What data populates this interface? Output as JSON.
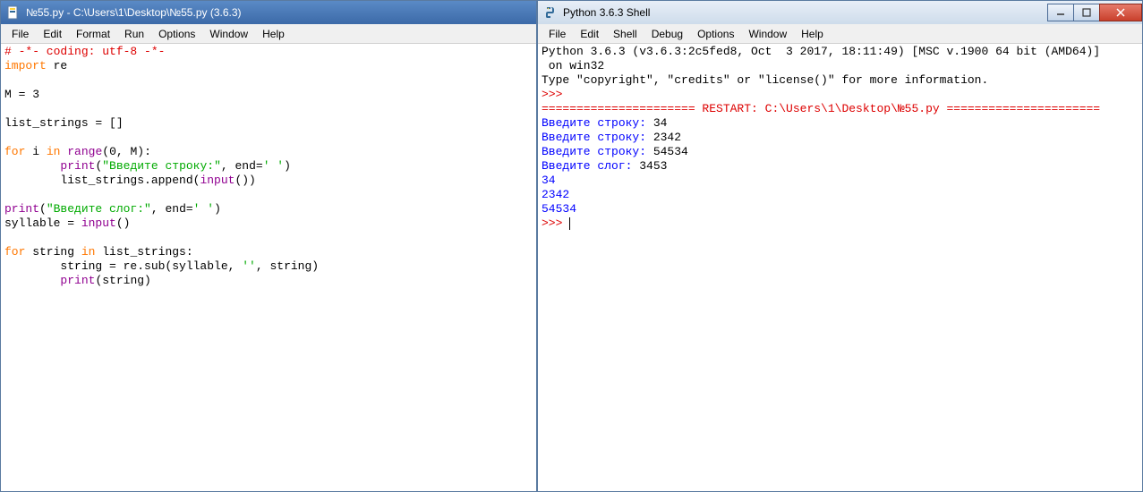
{
  "editor": {
    "title": "№55.py - C:\\Users\\1\\Desktop\\№55.py (3.6.3)",
    "menus": [
      "File",
      "Edit",
      "Format",
      "Run",
      "Options",
      "Window",
      "Help"
    ],
    "code": {
      "l1a": "# -*- coding: utf-8 -*-",
      "l2a": "import",
      "l2b": " re",
      "l3a": "M = ",
      "l3b": "3",
      "l4a": "list_strings = []",
      "l5a": "for",
      "l5b": " i ",
      "l5c": "in",
      "l5d": " ",
      "l5e": "range",
      "l5f": "(",
      "l5g": "0",
      "l5h": ", M):",
      "l6a": "        ",
      "l6b": "print",
      "l6c": "(",
      "l6d": "\"Введите строку:\"",
      "l6e": ", end=",
      "l6f": "' '",
      "l6g": ")",
      "l7a": "        list_strings.append(",
      "l7b": "input",
      "l7c": "())",
      "l8a": "print",
      "l8b": "(",
      "l8c": "\"Введите слог:\"",
      "l8d": ", end=",
      "l8e": "' '",
      "l8f": ")",
      "l9a": "syllable = ",
      "l9b": "input",
      "l9c": "()",
      "l10a": "for",
      "l10b": " string ",
      "l10c": "in",
      "l10d": " list_strings:",
      "l11a": "        string = re.sub(syllable, ",
      "l11b": "''",
      "l11c": ", string)",
      "l12a": "        ",
      "l12b": "print",
      "l12c": "(string)"
    }
  },
  "shell": {
    "title": "Python 3.6.3 Shell",
    "menus": [
      "File",
      "Edit",
      "Shell",
      "Debug",
      "Options",
      "Window",
      "Help"
    ],
    "output": {
      "banner1": "Python 3.6.3 (v3.6.3:2c5fed8, Oct  3 2017, 18:11:49) [MSC v.1900 64 bit (AMD64)]\n on win32",
      "banner2": "Type \"copyright\", \"credits\" or \"license()\" for more information.",
      "prompt": ">>>",
      "restart": "====================== RESTART: C:\\Users\\1\\Desktop\\№55.py ======================",
      "in1a": "Введите строку:",
      "in1b": " 34",
      "in2a": "Введите строку:",
      "in2b": " 2342",
      "in3a": "Введите строку:",
      "in3b": " 54534",
      "in4a": "Введите слог:",
      "in4b": " 3453",
      "out1": "34",
      "out2": "2342",
      "out3": "54534"
    }
  }
}
